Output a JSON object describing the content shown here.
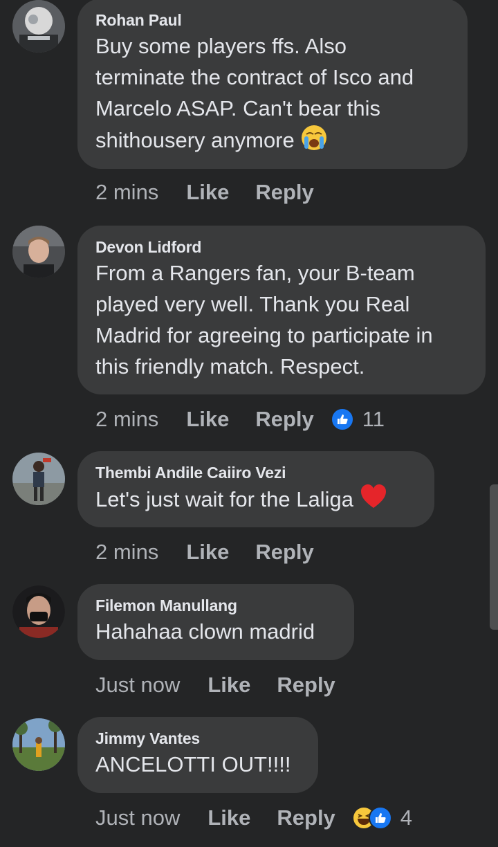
{
  "comments": [
    {
      "author": "Rohan Paul",
      "text": "Buy some players ffs. Also\nterminate the contract of Isco and\nMarcelo ASAP. Can't bear this\nshithousery anymore",
      "time": "2 mins",
      "like_label": "Like",
      "reply_label": "Reply",
      "emoji": "crying-face"
    },
    {
      "author": "Devon Lidford",
      "text": "From a Rangers fan, your B-team\nplayed very well. Thank you Real\nMadrid for agreeing to participate in\nthis friendly match. Respect.",
      "time": "2 mins",
      "like_label": "Like",
      "reply_label": "Reply",
      "reactions": [
        "like"
      ],
      "reaction_count": "11"
    },
    {
      "author": "Thembi Andile Caiiro Vezi",
      "text": "Let's just wait for the Laliga",
      "time": "2 mins",
      "like_label": "Like",
      "reply_label": "Reply",
      "emoji": "red-heart"
    },
    {
      "author": "Filemon Manullang",
      "text": "Hahahaa clown madrid",
      "time": "Just now",
      "like_label": "Like",
      "reply_label": "Reply"
    },
    {
      "author": "Jimmy Vantes",
      "text": "ANCELOTTI OUT!!!!",
      "time": "Just now",
      "like_label": "Like",
      "reply_label": "Reply",
      "reactions": [
        "haha",
        "like"
      ],
      "reaction_count": "4"
    }
  ],
  "colors": {
    "background": "#242526",
    "bubble": "#3a3b3c",
    "text": "#e4e6eb",
    "muted": "#b0b3b8",
    "like_blue": "#1877f2"
  }
}
